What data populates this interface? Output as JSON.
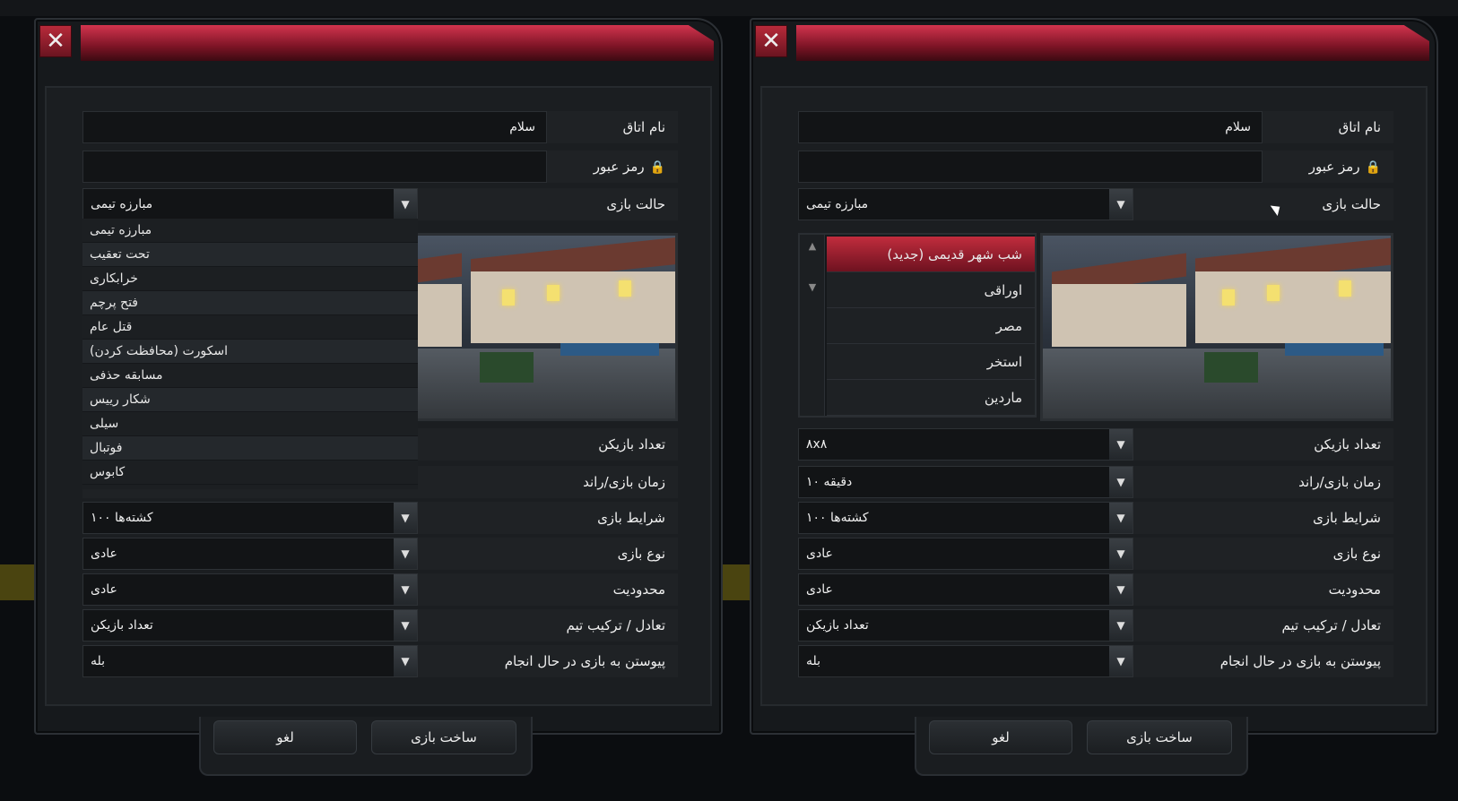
{
  "colors": {
    "accent": "#c12c3d",
    "panel": "#1b1e21",
    "field": "#121416"
  },
  "left_dialog": {
    "close_label": "✕",
    "room_name_label": "نام اتاق",
    "room_name_value": "سلام",
    "password_label": "رمز عبور",
    "game_mode_label": "حالت بازی",
    "game_mode_value": "مبارزه تیمی",
    "mode_options": [
      "مبارزه تیمی",
      "تحت تعقیب",
      "خرابکاری",
      "فتح پرچم",
      "قتل عام",
      "اسکورت (محافظت کردن)",
      "مسابقه حذفی",
      "شکار رییس",
      "سیلی",
      "فوتبال",
      "کابوس"
    ],
    "players_label": "تعداد بازیکن",
    "time_label": "زمان بازی/راند",
    "conditions_label": "شرایط بازی",
    "conditions_value": "کشته‌ها ۱۰۰",
    "type_label": "نوع بازی",
    "type_value": "عادی",
    "limit_label": "محدودیت",
    "limit_value": "عادی",
    "balance_label": "تعادل / ترکیب تیم",
    "balance_value": "تعداد بازیکن",
    "join_label": "پیوستن به بازی در حال انجام",
    "join_value": "بله",
    "create_button": "ساخت بازی",
    "cancel_button": "لغو"
  },
  "right_dialog": {
    "close_label": "✕",
    "room_name_label": "نام اتاق",
    "room_name_value": "سلام",
    "password_label": "رمز عبور",
    "game_mode_label": "حالت بازی",
    "game_mode_value": "مبارزه تیمی",
    "maps": [
      "شب شهر قدیمی (جدید)",
      "اوراقی",
      "مصر",
      "استخر",
      "ماردین"
    ],
    "selected_map": 0,
    "players_label": "تعداد بازیکن",
    "players_value": "۸x۸",
    "time_label": "زمان بازی/راند",
    "time_value": "۱۰ دقیقه",
    "conditions_label": "شرایط بازی",
    "conditions_value": "کشته‌ها ۱۰۰",
    "type_label": "نوع بازی",
    "type_value": "عادی",
    "limit_label": "محدودیت",
    "limit_value": "عادی",
    "balance_label": "تعادل / ترکیب تیم",
    "balance_value": "تعداد بازیکن",
    "join_label": "پیوستن به بازی در حال انجام",
    "join_value": "بله",
    "create_button": "ساخت بازی",
    "cancel_button": "لغو"
  },
  "icons": {
    "close": "close-icon",
    "lock": "lock-icon",
    "dropdown": "chevron-down-icon",
    "scroll_up": "arrow-up-icon",
    "scroll_down": "arrow-down-icon"
  }
}
